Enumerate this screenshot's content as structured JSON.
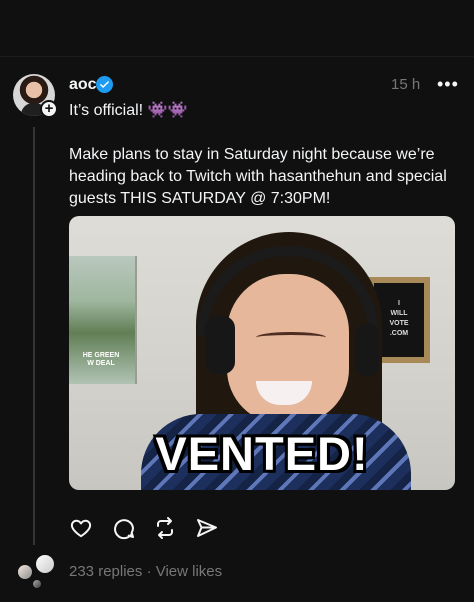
{
  "post": {
    "username": "aoc",
    "time": "15 h",
    "line1": "It’s official! 👾👾",
    "body": "Make plans to stay in Saturday night because we’re heading back to Twitch with hasanthehun and special guests THIS SATURDAY @ 7:30PM!",
    "media_caption": "VENTED!",
    "poster_text": "HE GREEN\nW DEAL",
    "board_text": "I\nWILL\nVOTE\n.COM"
  },
  "footer": {
    "replies": "233 replies",
    "separator": "·",
    "view_likes": "View likes"
  },
  "icons": {
    "verified": "verified-badge-icon",
    "more": "more-options-icon",
    "like": "heart-icon",
    "reply": "comment-icon",
    "repost": "repost-icon",
    "share": "send-icon"
  },
  "colors": {
    "background": "#101010",
    "text": "#f3f5f7",
    "muted": "#777777",
    "verified": "#1d9bf0",
    "thread_line": "#333638"
  }
}
